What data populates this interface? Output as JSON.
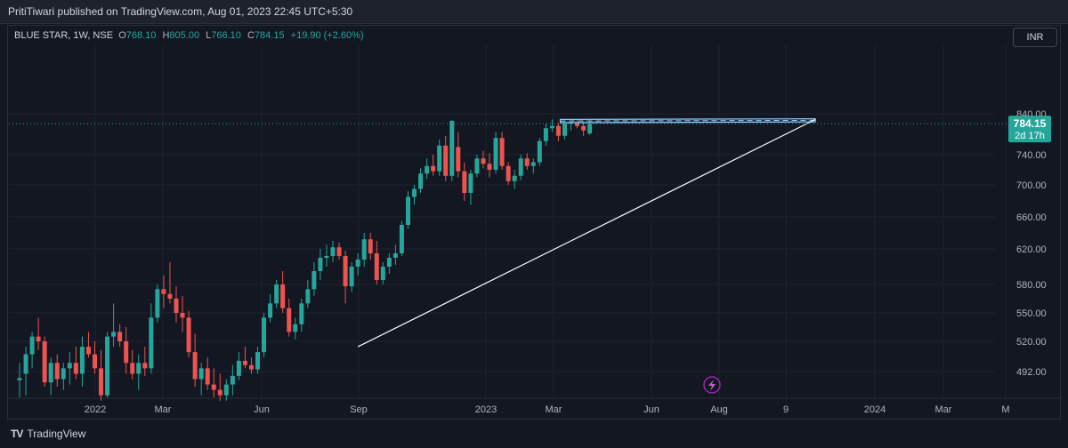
{
  "header": {
    "published": "PritiTiwari published on TradingView.com, Aug 01, 2023 22:45 UTC+5:30"
  },
  "legend": {
    "symbol": "BLUE STAR, 1W, NSE",
    "o_label": "O",
    "o_value": "768.10",
    "h_label": "H",
    "h_value": "805.00",
    "l_label": "L",
    "l_value": "766.10",
    "c_label": "C",
    "c_value": "784.15",
    "change": "+19.90 (+2.60%)"
  },
  "currency_button": "INR",
  "footer": {
    "brand": "TradingView",
    "logo": "TV"
  },
  "colors": {
    "up": "#26a69a",
    "down": "#ef5350",
    "bg": "#131722",
    "grid": "#1f2330",
    "axis_text": "#b2b5be",
    "trend": "#ffffff",
    "zone_fill": "#1e3a5f",
    "zone_edge": "#90caf9",
    "price_tag": "#26a69a"
  },
  "icons": {
    "bolt": "lightning-bolt-icon",
    "logo": "tradingview-logo-icon"
  },
  "chart_data": {
    "type": "candlestick",
    "price_axis": {
      "ticks": [
        "840.00",
        "780.00",
        "740.00",
        "700.00",
        "660.00",
        "620.00",
        "580.00",
        "550.00",
        "520.00",
        "492.00"
      ],
      "ylim": [
        465,
        870
      ]
    },
    "time_axis": {
      "ticks": [
        "2022",
        "Mar",
        "Jun",
        "Sep",
        "2023",
        "Mar",
        "Jun",
        "Aug",
        "9",
        "2024",
        "Mar",
        "M"
      ]
    },
    "current_price": {
      "label": "784.15",
      "countdown": "2d 17h",
      "value": 784.15
    },
    "grid": true,
    "candles": [
      {
        "o": 484,
        "h": 500,
        "l": 468,
        "c": 486
      },
      {
        "o": 490,
        "h": 515,
        "l": 470,
        "c": 508
      },
      {
        "o": 508,
        "h": 530,
        "l": 495,
        "c": 525
      },
      {
        "o": 525,
        "h": 545,
        "l": 512,
        "c": 520
      },
      {
        "o": 520,
        "h": 525,
        "l": 478,
        "c": 482
      },
      {
        "o": 482,
        "h": 505,
        "l": 470,
        "c": 500
      },
      {
        "o": 500,
        "h": 508,
        "l": 478,
        "c": 485
      },
      {
        "o": 485,
        "h": 500,
        "l": 475,
        "c": 495
      },
      {
        "o": 495,
        "h": 510,
        "l": 480,
        "c": 500
      },
      {
        "o": 500,
        "h": 515,
        "l": 485,
        "c": 490
      },
      {
        "o": 490,
        "h": 525,
        "l": 478,
        "c": 515
      },
      {
        "o": 515,
        "h": 530,
        "l": 505,
        "c": 508
      },
      {
        "o": 508,
        "h": 520,
        "l": 490,
        "c": 495
      },
      {
        "o": 495,
        "h": 512,
        "l": 465,
        "c": 470
      },
      {
        "o": 470,
        "h": 530,
        "l": 468,
        "c": 525
      },
      {
        "o": 525,
        "h": 560,
        "l": 515,
        "c": 530
      },
      {
        "o": 530,
        "h": 538,
        "l": 515,
        "c": 520
      },
      {
        "o": 520,
        "h": 535,
        "l": 490,
        "c": 500
      },
      {
        "o": 500,
        "h": 512,
        "l": 485,
        "c": 490
      },
      {
        "o": 490,
        "h": 508,
        "l": 475,
        "c": 500
      },
      {
        "o": 500,
        "h": 515,
        "l": 488,
        "c": 495
      },
      {
        "o": 495,
        "h": 560,
        "l": 490,
        "c": 545
      },
      {
        "o": 545,
        "h": 580,
        "l": 540,
        "c": 575
      },
      {
        "o": 575,
        "h": 590,
        "l": 555,
        "c": 570
      },
      {
        "o": 570,
        "h": 605,
        "l": 560,
        "c": 565
      },
      {
        "o": 565,
        "h": 578,
        "l": 540,
        "c": 550
      },
      {
        "o": 550,
        "h": 568,
        "l": 530,
        "c": 545
      },
      {
        "o": 545,
        "h": 552,
        "l": 505,
        "c": 510
      },
      {
        "o": 510,
        "h": 528,
        "l": 478,
        "c": 485
      },
      {
        "o": 485,
        "h": 500,
        "l": 470,
        "c": 495
      },
      {
        "o": 495,
        "h": 505,
        "l": 475,
        "c": 480
      },
      {
        "o": 480,
        "h": 495,
        "l": 468,
        "c": 475
      },
      {
        "o": 475,
        "h": 490,
        "l": 465,
        "c": 470
      },
      {
        "o": 470,
        "h": 485,
        "l": 465,
        "c": 480
      },
      {
        "o": 480,
        "h": 498,
        "l": 470,
        "c": 488
      },
      {
        "o": 488,
        "h": 510,
        "l": 484,
        "c": 502
      },
      {
        "o": 502,
        "h": 515,
        "l": 495,
        "c": 498
      },
      {
        "o": 498,
        "h": 505,
        "l": 490,
        "c": 494
      },
      {
        "o": 494,
        "h": 515,
        "l": 490,
        "c": 510
      },
      {
        "o": 510,
        "h": 550,
        "l": 505,
        "c": 545
      },
      {
        "o": 545,
        "h": 570,
        "l": 540,
        "c": 560
      },
      {
        "o": 560,
        "h": 585,
        "l": 555,
        "c": 580
      },
      {
        "o": 580,
        "h": 595,
        "l": 550,
        "c": 555
      },
      {
        "o": 555,
        "h": 565,
        "l": 525,
        "c": 530
      },
      {
        "o": 530,
        "h": 545,
        "l": 522,
        "c": 538
      },
      {
        "o": 538,
        "h": 565,
        "l": 530,
        "c": 560
      },
      {
        "o": 560,
        "h": 585,
        "l": 555,
        "c": 575
      },
      {
        "o": 575,
        "h": 605,
        "l": 568,
        "c": 595
      },
      {
        "o": 595,
        "h": 620,
        "l": 585,
        "c": 610
      },
      {
        "o": 610,
        "h": 625,
        "l": 600,
        "c": 612
      },
      {
        "o": 612,
        "h": 630,
        "l": 605,
        "c": 622
      },
      {
        "o": 622,
        "h": 628,
        "l": 608,
        "c": 612
      },
      {
        "o": 612,
        "h": 618,
        "l": 560,
        "c": 578
      },
      {
        "o": 578,
        "h": 605,
        "l": 572,
        "c": 600
      },
      {
        "o": 600,
        "h": 615,
        "l": 590,
        "c": 608
      },
      {
        "o": 608,
        "h": 640,
        "l": 600,
        "c": 632
      },
      {
        "o": 632,
        "h": 640,
        "l": 608,
        "c": 615
      },
      {
        "o": 615,
        "h": 630,
        "l": 580,
        "c": 585
      },
      {
        "o": 585,
        "h": 605,
        "l": 580,
        "c": 600
      },
      {
        "o": 600,
        "h": 615,
        "l": 592,
        "c": 610
      },
      {
        "o": 610,
        "h": 625,
        "l": 602,
        "c": 615
      },
      {
        "o": 615,
        "h": 655,
        "l": 612,
        "c": 650
      },
      {
        "o": 650,
        "h": 692,
        "l": 645,
        "c": 685
      },
      {
        "o": 685,
        "h": 700,
        "l": 675,
        "c": 695
      },
      {
        "o": 695,
        "h": 722,
        "l": 690,
        "c": 715
      },
      {
        "o": 715,
        "h": 735,
        "l": 708,
        "c": 725
      },
      {
        "o": 725,
        "h": 740,
        "l": 712,
        "c": 718
      },
      {
        "o": 718,
        "h": 760,
        "l": 712,
        "c": 752
      },
      {
        "o": 752,
        "h": 765,
        "l": 705,
        "c": 712
      },
      {
        "o": 712,
        "h": 805,
        "l": 705,
        "c": 800
      },
      {
        "o": 750,
        "h": 770,
        "l": 710,
        "c": 718
      },
      {
        "o": 718,
        "h": 730,
        "l": 680,
        "c": 690
      },
      {
        "o": 690,
        "h": 720,
        "l": 675,
        "c": 715
      },
      {
        "o": 715,
        "h": 740,
        "l": 710,
        "c": 735
      },
      {
        "o": 735,
        "h": 745,
        "l": 722,
        "c": 728
      },
      {
        "o": 728,
        "h": 742,
        "l": 710,
        "c": 720
      },
      {
        "o": 720,
        "h": 770,
        "l": 715,
        "c": 762
      },
      {
        "o": 762,
        "h": 770,
        "l": 720,
        "c": 725
      },
      {
        "o": 725,
        "h": 730,
        "l": 700,
        "c": 705
      },
      {
        "o": 705,
        "h": 720,
        "l": 695,
        "c": 712
      },
      {
        "o": 712,
        "h": 740,
        "l": 706,
        "c": 735
      },
      {
        "o": 735,
        "h": 742,
        "l": 720,
        "c": 725
      },
      {
        "o": 725,
        "h": 735,
        "l": 715,
        "c": 730
      },
      {
        "o": 730,
        "h": 762,
        "l": 725,
        "c": 758
      },
      {
        "o": 758,
        "h": 785,
        "l": 752,
        "c": 775
      },
      {
        "o": 775,
        "h": 808,
        "l": 770,
        "c": 778
      },
      {
        "o": 778,
        "h": 788,
        "l": 758,
        "c": 765
      },
      {
        "o": 765,
        "h": 790,
        "l": 760,
        "c": 785
      },
      {
        "o": 785,
        "h": 795,
        "l": 772,
        "c": 790
      },
      {
        "o": 790,
        "h": 805,
        "l": 775,
        "c": 778
      },
      {
        "o": 778,
        "h": 790,
        "l": 765,
        "c": 772
      },
      {
        "o": 768.1,
        "h": 805,
        "l": 766.1,
        "c": 784.15
      }
    ],
    "trendline": {
      "from": {
        "i": 54,
        "price": 515
      },
      "to": {
        "i": 127,
        "price": 808
      }
    },
    "resistance_zone": {
      "from_i": 87,
      "to_i": 127,
      "top_start": 808,
      "top_end": 812,
      "bottom_start": 790,
      "bottom_end": 794,
      "mid_start": 799,
      "mid_end": 803
    }
  }
}
